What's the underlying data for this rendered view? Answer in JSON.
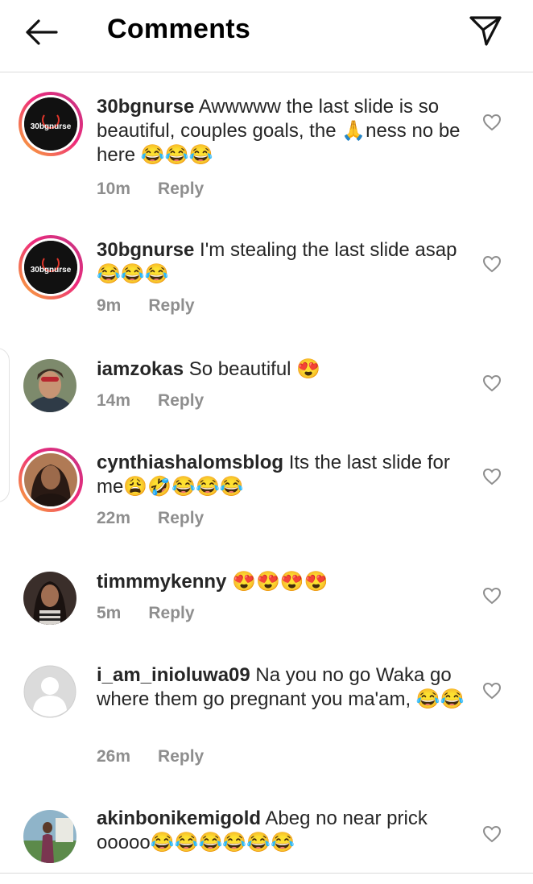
{
  "header": {
    "title": "Comments",
    "back_icon": "arrow-left-icon",
    "send_icon": "paper-plane-icon"
  },
  "reply_label": "Reply",
  "colors": {
    "story_ring_start": "#f9b233",
    "story_ring_end": "#c13584",
    "meta_text": "#8e8e8e",
    "text": "#262626"
  },
  "comments": [
    {
      "username": "30bgnurse",
      "text": "Awwwww the last slide is so beautiful, couples goals, the 🙏ness no be here 😂😂😂",
      "time": "10m",
      "avatar_label": "30bgnurse",
      "has_story": true
    },
    {
      "username": "30bgnurse",
      "text": "I'm stealing the last slide asap 😂😂😂",
      "time": "9m",
      "avatar_label": "30bgnurse",
      "has_story": true
    },
    {
      "username": "iamzokas",
      "text": "So beautiful 😍",
      "time": "14m",
      "has_story": false
    },
    {
      "username": "cynthiashalomsblog",
      "text": "Its the last slide for me😩🤣😂😂😂",
      "time": "22m",
      "has_story": true
    },
    {
      "username": "timmmykenny",
      "text": "😍😍😍😍",
      "time": "5m",
      "has_story": false
    },
    {
      "username": "i_am_inioluwa09",
      "text": "Na you no go Waka go where them go pregnant you ma'am, 😂😂",
      "time": "26m",
      "has_story": false
    },
    {
      "username": "akinbonikemigold",
      "text": "Abeg no near prick ooooo😂😂😂😂😂😂",
      "time": "",
      "has_story": false
    }
  ]
}
